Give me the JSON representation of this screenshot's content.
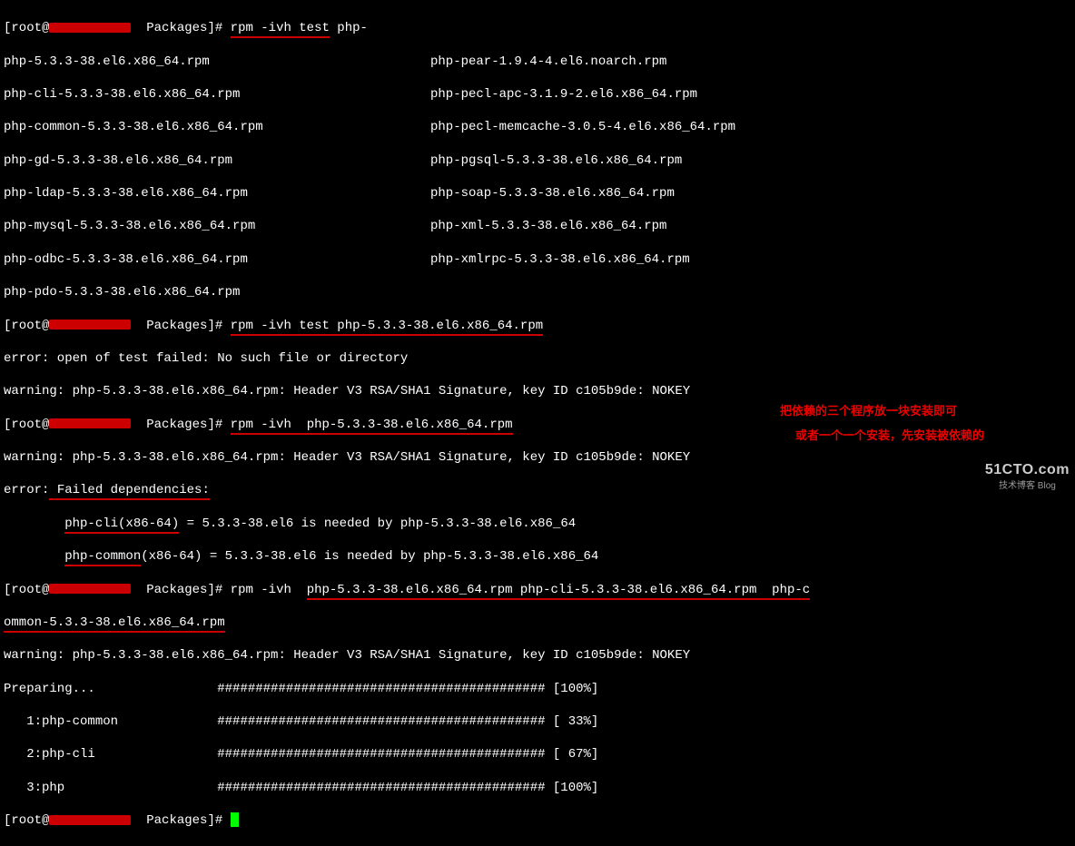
{
  "prompt": {
    "user": "root",
    "host": "",
    "dir": "Packages",
    "char": "#"
  },
  "cmd1": {
    "pre": "rpm -ivh test",
    "post": " php-"
  },
  "cols": [
    {
      "l": "php-5.3.3-38.el6.x86_64.rpm",
      "r": "php-pear-1.9.4-4.el6.noarch.rpm"
    },
    {
      "l": "php-cli-5.3.3-38.el6.x86_64.rpm",
      "r": "php-pecl-apc-3.1.9-2.el6.x86_64.rpm"
    },
    {
      "l": "php-common-5.3.3-38.el6.x86_64.rpm",
      "r": "php-pecl-memcache-3.0.5-4.el6.x86_64.rpm"
    },
    {
      "l": "php-gd-5.3.3-38.el6.x86_64.rpm",
      "r": "php-pgsql-5.3.3-38.el6.x86_64.rpm"
    },
    {
      "l": "php-ldap-5.3.3-38.el6.x86_64.rpm",
      "r": "php-soap-5.3.3-38.el6.x86_64.rpm"
    },
    {
      "l": "php-mysql-5.3.3-38.el6.x86_64.rpm",
      "r": "php-xml-5.3.3-38.el6.x86_64.rpm"
    },
    {
      "l": "php-odbc-5.3.3-38.el6.x86_64.rpm",
      "r": "php-xmlrpc-5.3.3-38.el6.x86_64.rpm"
    },
    {
      "l": "php-pdo-5.3.3-38.el6.x86_64.rpm",
      "r": ""
    }
  ],
  "cmd2": "rpm -ivh test php-5.3.3-38.el6.x86_64.rpm",
  "err_open": "error: open of test failed: No such file or directory",
  "warn_sig": "warning: php-5.3.3-38.el6.x86_64.rpm: Header V3 RSA/SHA1 Signature, key ID c105b9de: NOKEY",
  "cmd3": {
    "pre": "rpm -ivh ",
    "u": " php-5.3.3-38.el6.x86_64.rpm"
  },
  "err_dep_hdr": "error:",
  "err_dep_u": " Failed dependencies:",
  "dep1_u": "php-cli(x86-64)",
  "dep1_r": " = 5.3.3-38.el6 is needed by php-5.3.3-38.el6.x86_64",
  "dep2_u": "php-common",
  "dep2_r": "(x86-64) = 5.3.3-38.el6 is needed by php-5.3.3-38.el6.x86_64",
  "cmd4": {
    "pre": "rpm -ivh  ",
    "u1": "php-5.3.3-38.el6.x86_64.rpm php-cli-5.3.3-38.el6.x86_64.rpm  php-c",
    "u2": "ommon-5.3.3-38.el6.x86_64.rpm"
  },
  "prep": "Preparing...                ########################################### [100%]",
  "p1": "   1:php-common             ########################################### [ 33%]",
  "p2": "   2:php-cli                ########################################### [ 67%]",
  "p3": "   3:php                    ########################################### [100%]",
  "note1": "把依赖的三个程序放一块安装即可",
  "note2": "或者一个一个安装，先安装被依赖的",
  "wm_big": "51CTO.com",
  "wm_small": "技术博客 Blog"
}
